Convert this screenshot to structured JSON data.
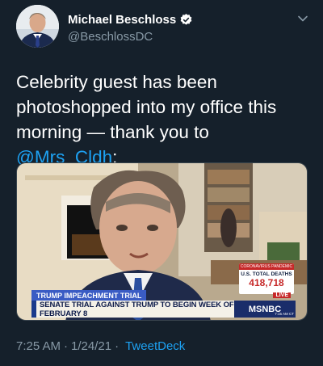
{
  "author": {
    "display_name": "Michael Beschloss",
    "handle": "@BeschlossDC",
    "verified": true
  },
  "tweet": {
    "text_before": "Celebrity guest has been photoshopped into my office this morning — thank you to ",
    "mention": "@Mrs_Cldh",
    "text_after": ":"
  },
  "media": {
    "tag": "TRUMP IMPEACHMENT TRIAL",
    "headline": "SENATE TRIAL AGAINST TRUMP TO BEGIN WEEK OF FEBRUARY 8",
    "stat_header": "CORONAVIRUS PANDEMIC",
    "stat_label": "U.S. TOTAL DEATHS",
    "stat_value": "418,718",
    "live_label": "LIVE",
    "network": "MSNBC",
    "network_time": "7:15 AM CT"
  },
  "meta": {
    "time": "7:25 AM",
    "separator": "·",
    "date": "1/24/21",
    "source": "TweetDeck"
  },
  "colors": {
    "background": "#15202b",
    "secondary_text": "#8899a6",
    "link": "#1da1f2"
  }
}
